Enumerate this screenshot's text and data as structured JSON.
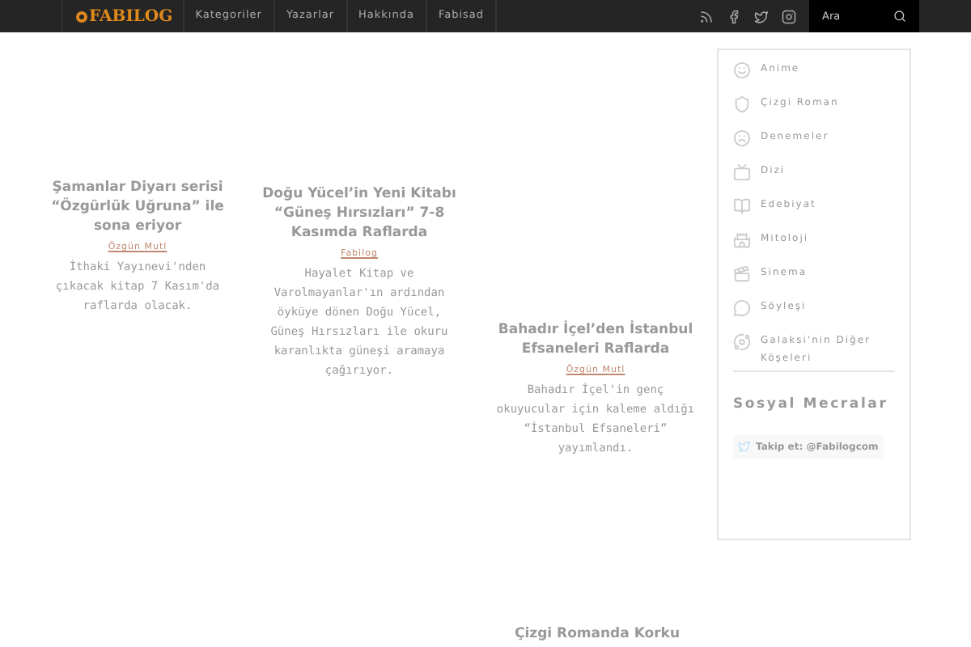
{
  "header": {
    "logo": "FABILOG",
    "nav": [
      {
        "label": "Kategoriler"
      },
      {
        "label": "Yazarlar"
      },
      {
        "label": "Hakkında"
      },
      {
        "label": "Fabisad"
      }
    ],
    "search": {
      "placeholder": "Ara"
    }
  },
  "posts": [
    {
      "title": "Şamanlar Diyarı serisi “Özgürlük Uğruna” ile sona eriyor",
      "author": "Özgün Mutl",
      "excerpt": "İthaki Yayınevi'nden çıkacak kitap 7 Kasım'da raflarda olacak."
    },
    {
      "title": "Doğu Yücel’in Yeni Kitabı “Güneş Hırsızları” 7-8 Kasımda Raflarda",
      "author": "Fabilog",
      "excerpt": "Hayalet Kitap ve Varolmayanlar'ın ardından öyküye dönen Doğu Yücel, Güneş Hırsızları ile okuru karanlıkta güneşi aramaya çağırıyor."
    },
    {
      "title": "Bahadır İçel’den İstanbul Efsaneleri Raflarda",
      "author": "Özgün Mutl",
      "excerpt": "Bahadır İçel'in genç okuyucular için kaleme aldığı “İstanbul Efsaneleri” yayımlandı."
    },
    {
      "title": "Çizgi Romanda Korku"
    }
  ],
  "sidebar": {
    "categories": [
      {
        "label": "Anime",
        "kind": "face"
      },
      {
        "label": "Çizgi Roman",
        "kind": "shield"
      },
      {
        "label": "Denemeler",
        "kind": "frown"
      },
      {
        "label": "Dizi",
        "kind": "tv"
      },
      {
        "label": "Edebiyat",
        "kind": "book"
      },
      {
        "label": "Mitoloji",
        "kind": "totem"
      },
      {
        "label": "Sinema",
        "kind": "clapper"
      },
      {
        "label": "Söyleşi",
        "kind": "chat"
      },
      {
        "label": "Galaksi'nin Diğer Köşeleri",
        "kind": "planet"
      }
    ],
    "social_title": "Sosyal Mecralar",
    "follow": "Takip et: @Fabilogcom"
  }
}
